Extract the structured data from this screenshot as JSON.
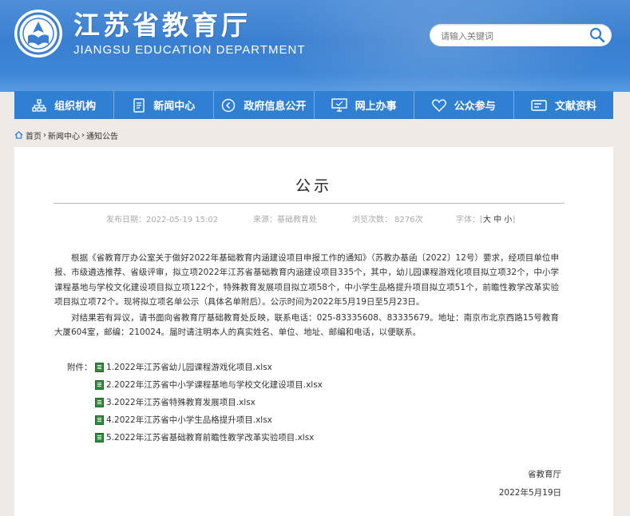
{
  "header": {
    "title": "江苏省教育厅",
    "subtitle": "JIANGSU EDUCATION DEPARTMENT",
    "search_placeholder": "请输入关键词"
  },
  "nav": [
    {
      "label": "组织机构",
      "icon": "org-chart-icon"
    },
    {
      "label": "新闻中心",
      "icon": "document-icon"
    },
    {
      "label": "政府信息公开",
      "icon": "speaker-icon"
    },
    {
      "label": "网上办事",
      "icon": "monitor-icon"
    },
    {
      "label": "公众参与",
      "icon": "heart-icon"
    },
    {
      "label": "文献资料",
      "icon": "card-icon"
    }
  ],
  "breadcrumb": [
    "首页",
    "新闻中心",
    "通知公告"
  ],
  "article": {
    "title": "公示",
    "publish_date": "发布日期：2022-05-19 15:02",
    "source": "来源：基础教育处",
    "views": "浏览次数：  8276次",
    "font_size_label": "字体：[",
    "font_sizes": [
      "大",
      "中",
      "小"
    ],
    "font_size_close": "]",
    "paragraphs": [
      "根据《省教育厅办公室关于做好2022年基础教育内涵建设项目申报工作的通知》（苏教办基函〔2022〕12号）要求，经项目单位申报、市级遴选推荐、省级评审，拟立项2022年江苏省基础教育内涵建设项目335个，其中，幼儿园课程游戏化项目拟立项32个，中小学课程基地与学校文化建设项目拟立项122个，特殊教育发展项目拟立项58个，中小学生品格提升项目拟立项51个，前瞻性教学改革实验项目拟立项72个。现将拟立项名单公示（具体名单附后）。公示时间为2022年5月19日至5月23日。",
      "对结果若有异议，请书面向省教育厅基础教育处反映，联系电话：025-83335608、83335679。地址：南京市北京西路15号教育大厦604室，邮编：210024。届时请注明本人的真实姓名、单位、地址、邮编和电话，以便联系。"
    ],
    "attachments_label": "附件：",
    "attachments": [
      "1.2022年江苏省幼儿园课程游戏化项目.xlsx",
      "2.2022年江苏省中小学课程基地与学校文化建设项目.xlsx",
      "3.2022年江苏省特殊教育发展项目.xlsx",
      "4.2022年江苏省中小学生品格提升项目.xlsx",
      "5.2022年江苏省基础教育前瞻性教学改革实验项目.xlsx"
    ],
    "signature_org": "省教育厅",
    "signature_date": "2022年5月19日"
  }
}
